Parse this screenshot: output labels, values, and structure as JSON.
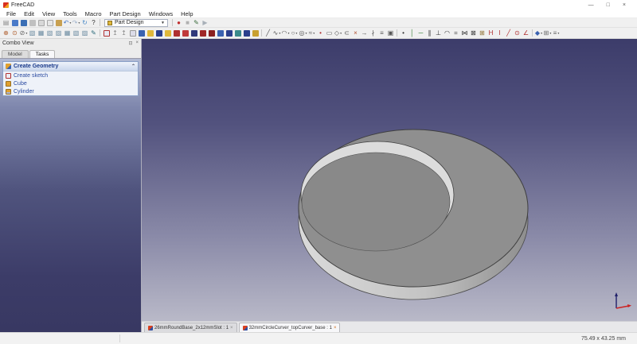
{
  "window": {
    "title": "FreeCAD",
    "controls": [
      {
        "name": "minimize",
        "glyph": "—"
      },
      {
        "name": "maximize",
        "glyph": "□"
      },
      {
        "name": "close",
        "glyph": "×"
      }
    ]
  },
  "menubar": {
    "items": [
      "File",
      "Edit",
      "View",
      "Tools",
      "Macro",
      "Part Design",
      "Windows",
      "Help"
    ]
  },
  "toolbars": {
    "workbench_selector": {
      "value": "Part Design"
    },
    "groups": {
      "file": [
        {
          "name": "new-file",
          "glyph": "▤",
          "fg": "#8a8a8a"
        },
        {
          "name": "open-file",
          "bg": "#4a7ac8"
        },
        {
          "name": "save-file",
          "bg": "#3b6fb5"
        },
        {
          "name": "print",
          "bg": "#c0c0c0"
        },
        {
          "name": "cut",
          "bg": "#d8d8d8",
          "border": "#a8a8a8"
        },
        {
          "name": "copy",
          "bg": "#e6e6e6",
          "border": "#a8a8a8"
        },
        {
          "name": "paste",
          "bg": "#c8a050"
        },
        {
          "name": "undo",
          "glyph": "↶",
          "fg": "#4a7ac8",
          "dd": true
        },
        {
          "name": "redo",
          "glyph": "↷",
          "fg": "#a0b4cc",
          "dd": true
        },
        {
          "name": "refresh",
          "glyph": "↻",
          "fg": "#4a8ac8"
        },
        {
          "name": "whats-this",
          "glyph": "?",
          "fg": "#333333"
        }
      ],
      "macro": [
        {
          "name": "macro-record",
          "glyph": "●",
          "fg": "#c03030"
        },
        {
          "name": "macro-stop",
          "glyph": "■",
          "fg": "#b0b0b0"
        },
        {
          "name": "macro-edit",
          "glyph": "✎",
          "fg": "#3a6a3a"
        },
        {
          "name": "macro-execute",
          "glyph": "▶",
          "fg": "#a8b0b8"
        }
      ],
      "view": [
        {
          "name": "fit-all",
          "glyph": "⊕",
          "fg": "#b06030"
        },
        {
          "name": "zoom-selection",
          "glyph": "⊙",
          "fg": "#b06030"
        },
        {
          "name": "draw-style",
          "glyph": "⊘",
          "fg": "#666666",
          "dd": true
        },
        {
          "name": "view-isometric",
          "glyph": "▧",
          "fg": "#6a8aa0"
        },
        {
          "name": "view-front",
          "glyph": "▦",
          "fg": "#6a8aa0"
        },
        {
          "name": "view-top",
          "glyph": "▧",
          "fg": "#6a8aa0"
        },
        {
          "name": "view-right",
          "glyph": "▨",
          "fg": "#6a8aa0"
        },
        {
          "name": "view-rear",
          "glyph": "▦",
          "fg": "#6a8aa0"
        },
        {
          "name": "view-bottom",
          "glyph": "▧",
          "fg": "#6a8aa0"
        },
        {
          "name": "view-left",
          "glyph": "▨",
          "fg": "#6a8aa0"
        },
        {
          "name": "measure",
          "glyph": "✎",
          "fg": "#2a6a7a"
        }
      ],
      "partdesign": [
        {
          "name": "create-sketch",
          "bg": "#e8e8f2",
          "border": "#b03030"
        },
        {
          "name": "edit-sketch",
          "glyph": "↥",
          "fg": "#888888"
        },
        {
          "name": "map-sketch-to-face",
          "glyph": "↥",
          "fg": "#888888"
        },
        {
          "name": "validate-sketch",
          "bg": "#dcdce8",
          "border": "#999999"
        },
        {
          "name": "create-body",
          "bg": "#3a62b0"
        },
        {
          "name": "pad",
          "bg": "#e0b83a"
        },
        {
          "name": "pocket",
          "bg": "#2b3f8c"
        },
        {
          "name": "revolution",
          "bg": "#e0b83a"
        },
        {
          "name": "groove",
          "bg": "#b03030"
        },
        {
          "name": "hole",
          "bg": "#c03a3a"
        },
        {
          "name": "linear-pattern",
          "bg": "#30387a"
        },
        {
          "name": "polar-pattern",
          "bg": "#a02828"
        },
        {
          "name": "mirrored",
          "bg": "#8a2020"
        },
        {
          "name": "fillet",
          "bg": "#3a62b0"
        },
        {
          "name": "chamfer",
          "bg": "#2b3f8c"
        },
        {
          "name": "draft",
          "bg": "#3a8a8a"
        },
        {
          "name": "thickness",
          "bg": "#2b3f8c"
        },
        {
          "name": "boolean-operation",
          "bg": "#c8a030"
        }
      ],
      "sketcher_geometry": [
        {
          "name": "create-line",
          "glyph": "╱",
          "fg": "#555555"
        },
        {
          "name": "create-polyline",
          "glyph": "∿",
          "fg": "#555555",
          "dd": true
        },
        {
          "name": "create-arc",
          "glyph": "◠",
          "fg": "#555555",
          "dd": true
        },
        {
          "name": "create-circle",
          "glyph": "○",
          "fg": "#555555",
          "dd": true
        },
        {
          "name": "create-conic",
          "glyph": "◎",
          "fg": "#555555",
          "dd": true
        },
        {
          "name": "create-bspline",
          "glyph": "≈",
          "fg": "#555555",
          "dd": true
        },
        {
          "name": "create-point",
          "glyph": "•",
          "fg": "#b03030"
        },
        {
          "name": "create-rectangle",
          "glyph": "▭",
          "fg": "#555555"
        },
        {
          "name": "create-polygon",
          "glyph": "◇",
          "fg": "#555555",
          "dd": true
        },
        {
          "name": "create-slot",
          "glyph": "⊂",
          "fg": "#555555"
        },
        {
          "name": "trim-edge",
          "glyph": "×",
          "fg": "#b05030"
        },
        {
          "name": "extend-edge",
          "glyph": "→",
          "fg": "#555555"
        },
        {
          "name": "split-edge",
          "glyph": "∤",
          "fg": "#555555"
        },
        {
          "name": "external-geometry",
          "glyph": "≡",
          "fg": "#555555"
        },
        {
          "name": "carbon-copy",
          "glyph": "▣",
          "fg": "#555555"
        }
      ],
      "sketcher_constraints": [
        {
          "name": "constrain-coincident",
          "glyph": "•",
          "fg": "#333333"
        },
        {
          "name": "constrain-vertical",
          "glyph": "│",
          "fg": "#2a7a2a"
        },
        {
          "name": "constrain-horizontal",
          "glyph": "─",
          "fg": "#2a7a2a"
        },
        {
          "name": "constrain-parallel",
          "glyph": "∥",
          "fg": "#333333"
        },
        {
          "name": "constrain-perpendicular",
          "glyph": "⊥",
          "fg": "#333333"
        },
        {
          "name": "constrain-tangent",
          "glyph": "◠",
          "fg": "#333333"
        },
        {
          "name": "constrain-equal",
          "glyph": "=",
          "fg": "#333333"
        },
        {
          "name": "constrain-symmetric",
          "glyph": "⋈",
          "fg": "#333333"
        },
        {
          "name": "constrain-block",
          "glyph": "⊠",
          "fg": "#333333"
        },
        {
          "name": "constrain-lock",
          "glyph": "⊞",
          "fg": "#8a6a2a"
        },
        {
          "name": "constrain-horizontal-distance",
          "glyph": "H",
          "fg": "#b03030"
        },
        {
          "name": "constrain-vertical-distance",
          "glyph": "I",
          "fg": "#b03030"
        },
        {
          "name": "constrain-distance",
          "glyph": "╱",
          "fg": "#b03030"
        },
        {
          "name": "constrain-radius",
          "glyph": "⊙",
          "fg": "#b03030"
        },
        {
          "name": "constrain-angle",
          "glyph": "∠",
          "fg": "#b03030"
        }
      ],
      "sketcher_tools": [
        {
          "name": "toggle-driving-constraint",
          "glyph": "◆",
          "fg": "#3a62b0",
          "dd": true
        },
        {
          "name": "snap-options",
          "glyph": "⊞",
          "fg": "#666666",
          "dd": true
        },
        {
          "name": "rendering-order",
          "glyph": "≡",
          "fg": "#666666",
          "dd": true
        }
      ]
    }
  },
  "combo_view": {
    "title": "Combo View",
    "tabs": [
      {
        "label": "Model",
        "active": false
      },
      {
        "label": "Tasks",
        "active": true
      }
    ],
    "task_panel": {
      "header": "Create Geometry",
      "items": [
        {
          "label": "Create sketch",
          "icon": "sketch"
        },
        {
          "label": "Cube",
          "icon": "cube"
        },
        {
          "label": "Cylinder",
          "icon": "cylinder"
        }
      ]
    }
  },
  "viewport": {
    "background_top": "#3c3c6a",
    "background_bottom": "#b9b9c8",
    "model": {
      "description": "gray disc with offset circular recess forming a crescent",
      "top_face": "#8f8f8f",
      "side_light": "#dadada",
      "side_dark": "#8e8e8e",
      "recess_floor": "#898989",
      "recess_rim_highlight": "#dcdcdc",
      "edge": "#3f3f3f"
    },
    "axis_indicator": {
      "x_axis_color": "#cc2222",
      "y_axis_color": "#20206a"
    }
  },
  "document_tabs": [
    {
      "label": "26mmRoundBase_2x12mmSlot : 1",
      "active": false
    },
    {
      "label": "32mmCircleCurver_topCurver_base : 1",
      "active": true
    }
  ],
  "statusbar": {
    "dimension_readout": "75.49 x 43.25 mm"
  }
}
